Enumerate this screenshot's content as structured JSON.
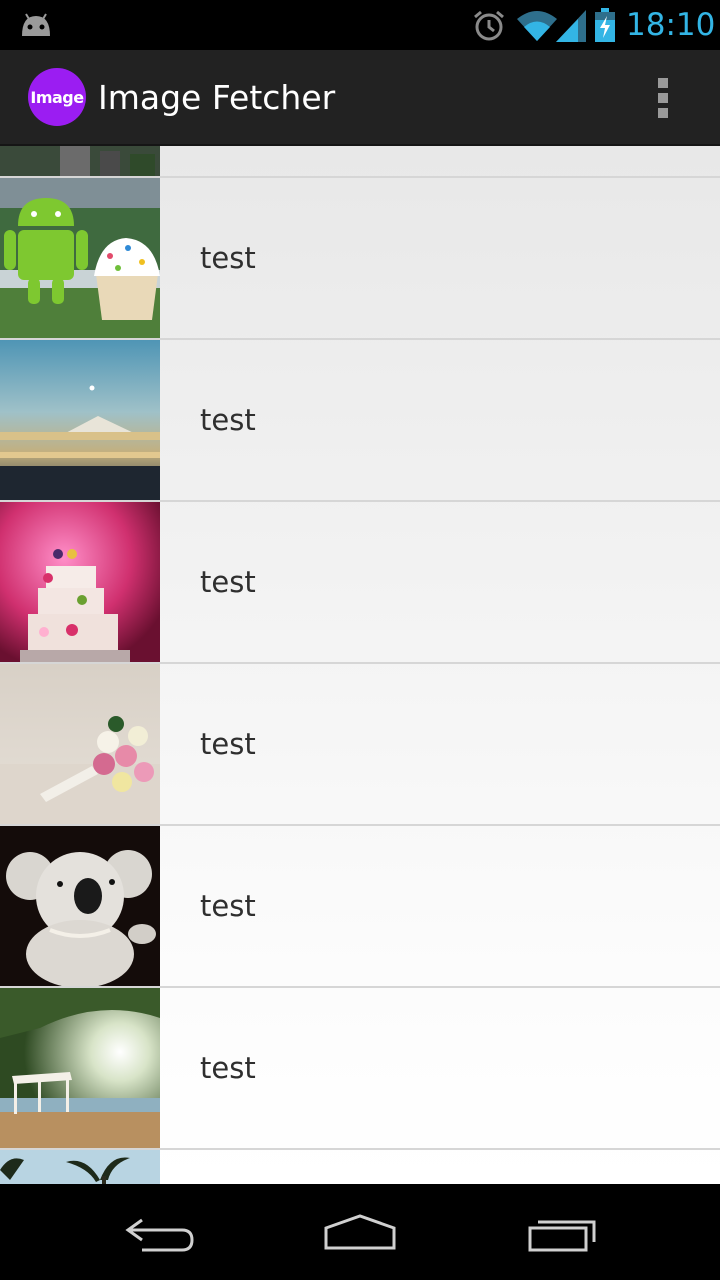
{
  "status_bar": {
    "time": "18:10",
    "accent_color": "#33b5e5",
    "icons": [
      "android-notification-icon",
      "alarm-icon",
      "wifi-icon",
      "signal-icon",
      "battery-charging-icon"
    ]
  },
  "action_bar": {
    "logo_text": "Image",
    "logo_color": "#9b1df2",
    "title": "Image Fetcher",
    "overflow_icon": "overflow-menu-icon"
  },
  "list": {
    "items": [
      {
        "label": "",
        "thumbnail": "city-night-thumbnail"
      },
      {
        "label": "test",
        "thumbnail": "android-statue-thumbnail"
      },
      {
        "label": "test",
        "thumbnail": "mountain-sky-thumbnail"
      },
      {
        "label": "test",
        "thumbnail": "wedding-cake-thumbnail"
      },
      {
        "label": "test",
        "thumbnail": "flower-bouquet-thumbnail"
      },
      {
        "label": "test",
        "thumbnail": "koala-toy-thumbnail"
      },
      {
        "label": "test",
        "thumbnail": "beach-gazebo-thumbnail"
      },
      {
        "label": "",
        "thumbnail": "palm-trees-thumbnail"
      }
    ]
  },
  "nav_bar": {
    "icons": [
      "back-icon",
      "home-icon",
      "recents-icon"
    ]
  }
}
